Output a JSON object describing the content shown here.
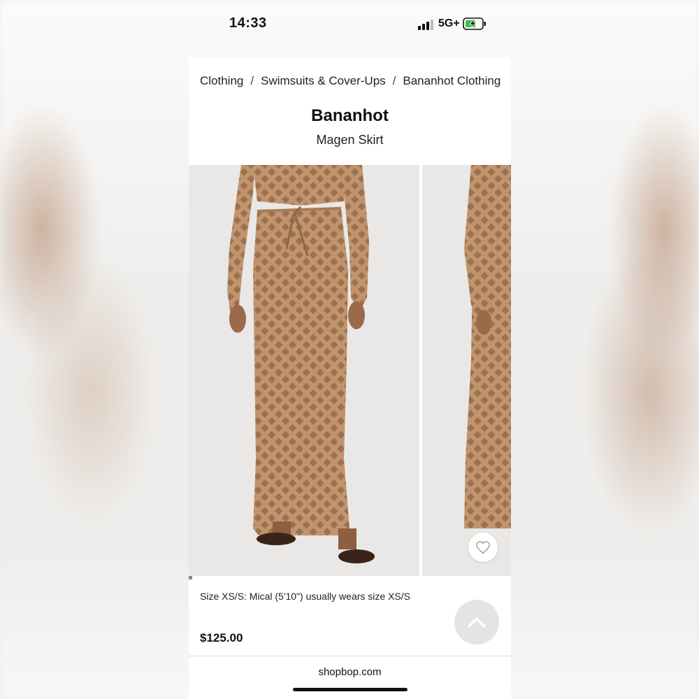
{
  "status_bar": {
    "time": "14:33",
    "network": "5G+",
    "signal_icon": "signal-bars-icon",
    "battery_icon": "battery-charging-icon"
  },
  "breadcrumb": {
    "items": [
      "Clothing",
      "Swimsuits & Cover-Ups",
      "Bananhot Clothing"
    ],
    "separator": "/"
  },
  "product": {
    "brand": "Bananhot",
    "name": "Magen Skirt",
    "size_note": "Size XS/S: Mical (5'10\") usually wears size XS/S",
    "price": "$125.00"
  },
  "gallery": {
    "images": [
      "crochet-maxi-skirt-front-photo",
      "crochet-maxi-skirt-side-photo"
    ],
    "wishlist_icon": "heart-icon"
  },
  "controls": {
    "back_to_top_icon": "chevron-up-icon"
  },
  "browser": {
    "url": "shopbop.com"
  },
  "colors": {
    "skirt": "#b98b63",
    "photo_background": "#e9e8e6",
    "text": "#111111"
  }
}
